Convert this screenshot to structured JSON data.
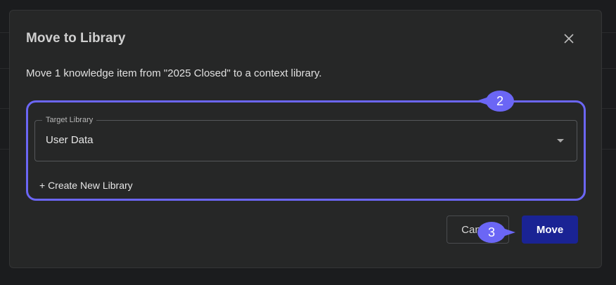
{
  "dialog": {
    "title": "Move to Library",
    "description": "Move 1 knowledge item from \"2025 Closed\" to a context library.",
    "target_library": {
      "label": "Target Library",
      "value": "User Data"
    },
    "create_library_label": "+ Create New Library",
    "cancel_label": "Cancel",
    "move_label": "Move"
  },
  "annotations": {
    "step_2": "2",
    "step_3": "3"
  },
  "colors": {
    "highlight": "#6b66f5",
    "primary_button": "#1a2394",
    "dialog_background": "#262727"
  },
  "icons": {
    "close": "close-icon",
    "dropdown": "chevron-down-icon"
  }
}
